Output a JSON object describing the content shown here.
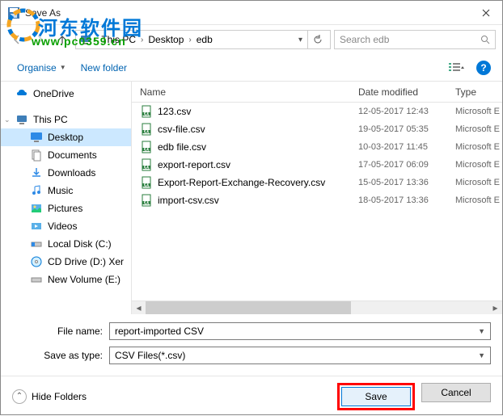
{
  "window": {
    "title": "Save As"
  },
  "watermark": {
    "text": "河东软件园",
    "url": "www.pc0359.cn"
  },
  "nav": {
    "crumbs": [
      "This PC",
      "Desktop",
      "edb"
    ],
    "search_placeholder": "Search edb"
  },
  "toolbar": {
    "organise": "Organise",
    "newfolder": "New folder"
  },
  "sidebar": {
    "onedrive": "OneDrive",
    "thispc": "This PC",
    "items": [
      {
        "label": "Desktop"
      },
      {
        "label": "Documents"
      },
      {
        "label": "Downloads"
      },
      {
        "label": "Music"
      },
      {
        "label": "Pictures"
      },
      {
        "label": "Videos"
      },
      {
        "label": "Local Disk (C:)"
      },
      {
        "label": "CD Drive (D:) Xer"
      },
      {
        "label": "New Volume (E:)"
      }
    ]
  },
  "columns": {
    "name": "Name",
    "date": "Date modified",
    "type": "Type"
  },
  "files": [
    {
      "name": "123.csv",
      "date": "12-05-2017 12:43",
      "type": "Microsoft E"
    },
    {
      "name": "csv-file.csv",
      "date": "19-05-2017 05:35",
      "type": "Microsoft E"
    },
    {
      "name": "edb file.csv",
      "date": "10-03-2017 11:45",
      "type": "Microsoft E"
    },
    {
      "name": "export-report.csv",
      "date": "17-05-2017 06:09",
      "type": "Microsoft E"
    },
    {
      "name": "Export-Report-Exchange-Recovery.csv",
      "date": "15-05-2017 13:36",
      "type": "Microsoft E"
    },
    {
      "name": "import-csv.csv",
      "date": "18-05-2017 13:36",
      "type": "Microsoft E"
    }
  ],
  "fields": {
    "filename_label": "File name:",
    "filename_value": "report-imported CSV",
    "saveastype_label": "Save as type:",
    "saveastype_value": "CSV Files(*.csv)"
  },
  "footer": {
    "hide_folders": "Hide Folders",
    "save": "Save",
    "cancel": "Cancel"
  }
}
